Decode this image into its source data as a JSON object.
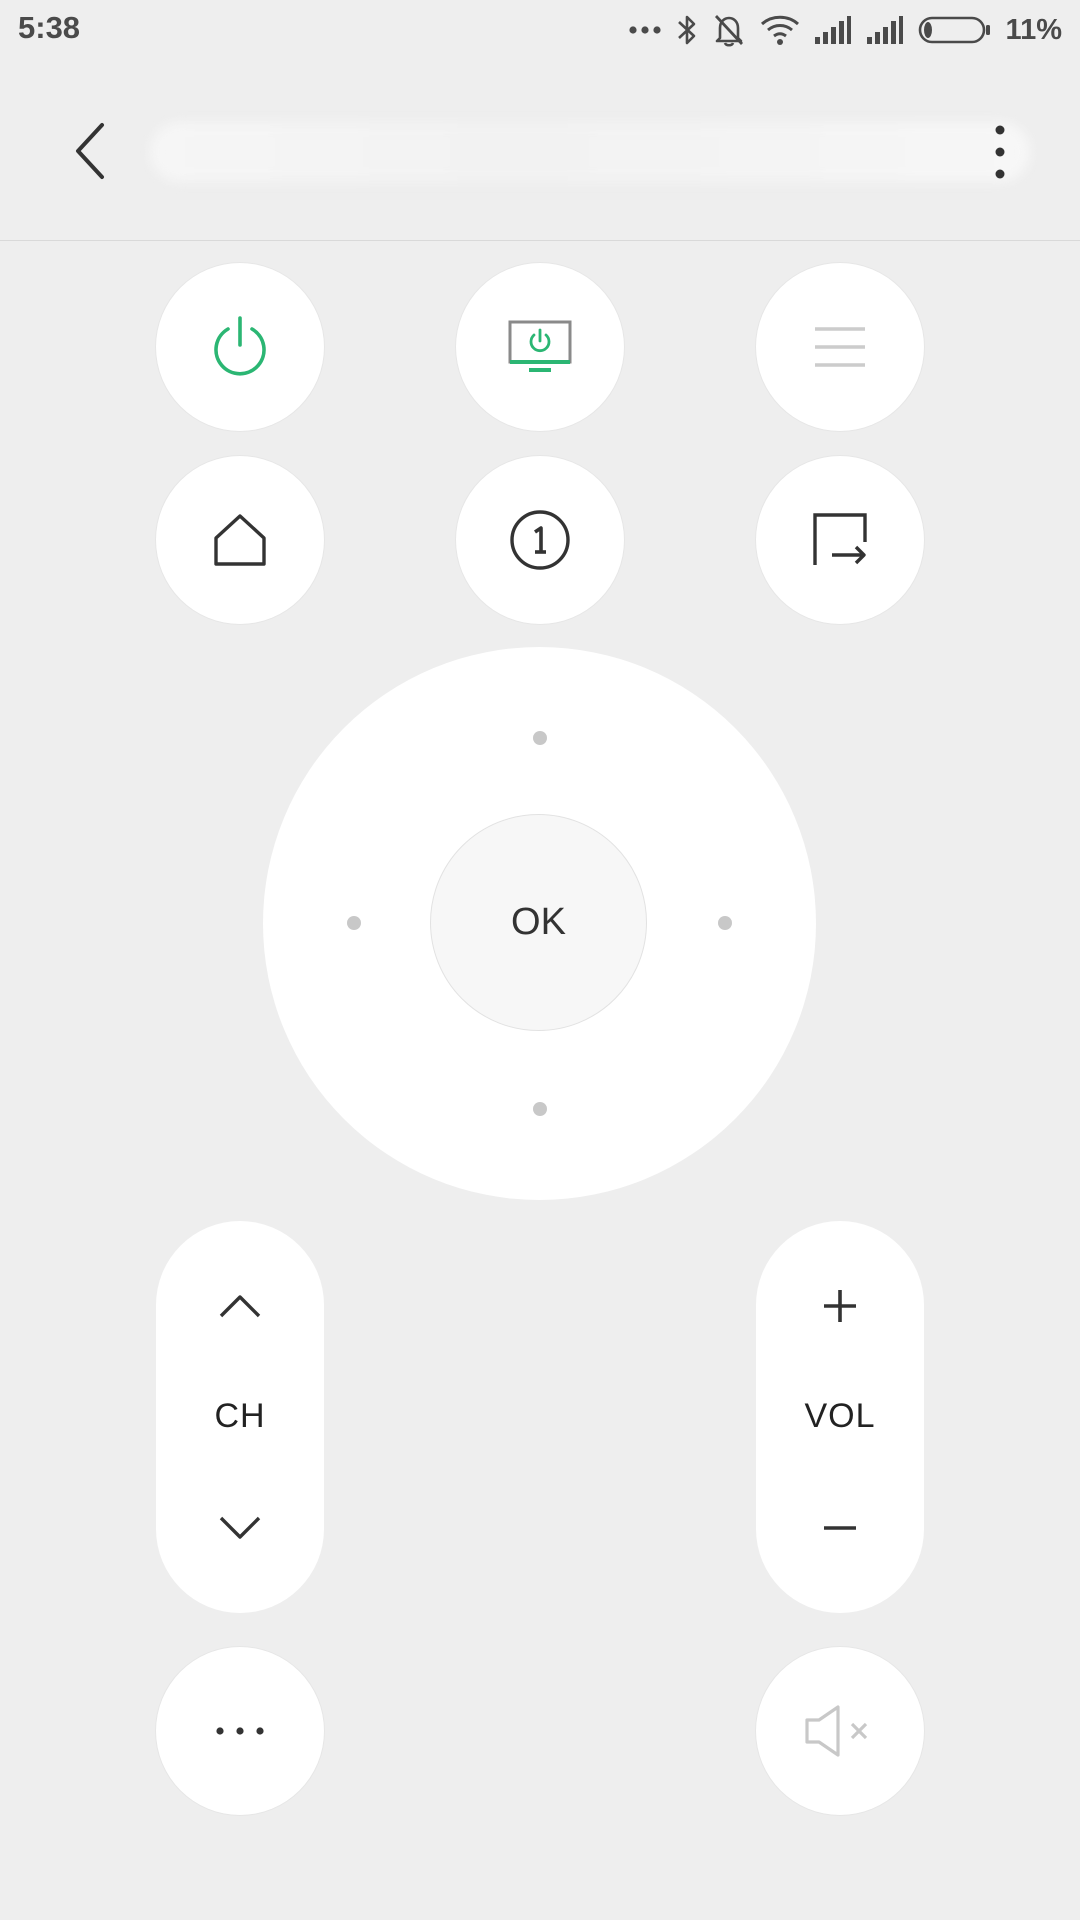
{
  "status_bar": {
    "time": "5:38",
    "battery_percent": "11%",
    "battery_level": 0.11,
    "icons": [
      "more-dots-icon",
      "bluetooth-icon",
      "notifications-muted-icon",
      "wifi-icon",
      "signal-icon",
      "signal-icon",
      "battery-icon"
    ]
  },
  "header": {
    "back_icon": "chevron-left-icon",
    "device_name": "",
    "menu_icon": "vertical-dots-icon"
  },
  "top_controls": [
    {
      "name": "power",
      "icon": "power-icon",
      "color": "#2bb673"
    },
    {
      "name": "tv-power",
      "icon": "tv-power-icon",
      "color": "#2bb673"
    },
    {
      "name": "menu",
      "icon": "hamburger-icon",
      "color": "#cccccc"
    },
    {
      "name": "home",
      "icon": "home-icon",
      "color": "#333333"
    },
    {
      "name": "number-pad",
      "icon": "numeric-one-icon",
      "color": "#333333"
    },
    {
      "name": "input-source",
      "icon": "exit-arrow-icon",
      "color": "#333333"
    }
  ],
  "dpad": {
    "ok_label": "OK"
  },
  "channel": {
    "label": "CH",
    "up_icon": "chevron-up-icon",
    "down_icon": "chevron-down-icon"
  },
  "volume": {
    "label": "VOL",
    "up_icon": "plus-icon",
    "down_icon": "minus-icon"
  },
  "bottom_controls": {
    "more_icon": "horizontal-dots-icon",
    "mute_icon": "speaker-muted-icon",
    "mute_color": "#c8c8c8"
  }
}
